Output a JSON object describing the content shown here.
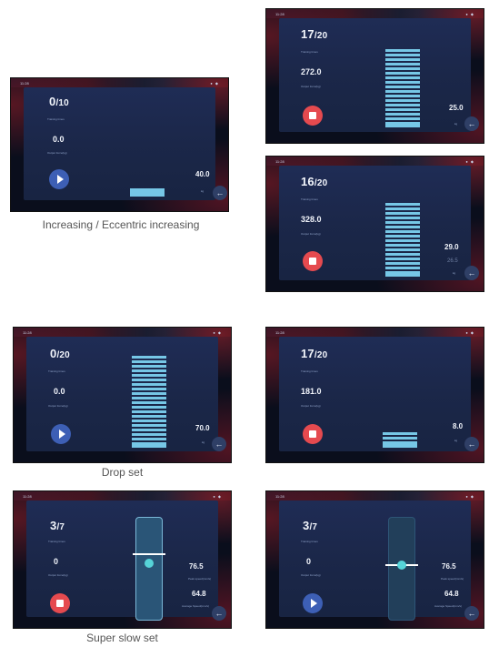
{
  "screens": {
    "s1": {
      "count": "0",
      "total": "/10",
      "label1": "Training times",
      "value": "0.0",
      "label2": "Output force(kg)",
      "weight": "40.0",
      "unit": "kg"
    },
    "s2": {
      "count": "17",
      "total": "/20",
      "label1": "Training times",
      "value": "272.0",
      "label2": "Output force(kg)",
      "weight": "25.0",
      "unit": "kg"
    },
    "s3": {
      "count": "16",
      "total": "/20",
      "label1": "Training times",
      "value": "328.0",
      "label2": "Output force(kg)",
      "weight": "29.0",
      "weight_prev": "26.5",
      "unit": "kg"
    },
    "s4": {
      "count": "0",
      "total": "/20",
      "label1": "Training times",
      "value": "0.0",
      "label2": "Output force(kg)",
      "weight": "70.0",
      "unit": "kg"
    },
    "s5": {
      "count": "17",
      "total": "/20",
      "label1": "Training times",
      "value": "181.0",
      "label2": "Output force(kg)",
      "weight": "8.0",
      "unit": "kg"
    },
    "s6": {
      "count": "3",
      "total": "/7",
      "label1": "Training times",
      "value": "0",
      "label2": "Output force(kg)",
      "speed": "76.5",
      "speed_label": "Peak speed(mm/s)",
      "avg": "64.8",
      "avg_label": "Average Speed(mm/s)"
    },
    "s7": {
      "count": "3",
      "total": "/7",
      "label1": "Training times",
      "value": "0",
      "label2": "Output force(kg)",
      "speed": "76.5",
      "speed_label": "Peak speed(mm/s)",
      "avg": "64.8",
      "avg_label": "Average Speed(mm/s)"
    }
  },
  "captions": {
    "increasing": "Increasing / Eccentric increasing",
    "drop": "Drop set",
    "superslow": "Super slow set"
  },
  "status": {
    "time": "11:28",
    "icons": "● ◆"
  },
  "icons": {
    "play": "play-icon",
    "stop": "stop-icon",
    "back": "back-arrow-icon"
  },
  "colors": {
    "bar": "#76c7e6",
    "stop": "#e54a4f",
    "play": "#3d5fb5",
    "panel": "#1f2c55"
  }
}
